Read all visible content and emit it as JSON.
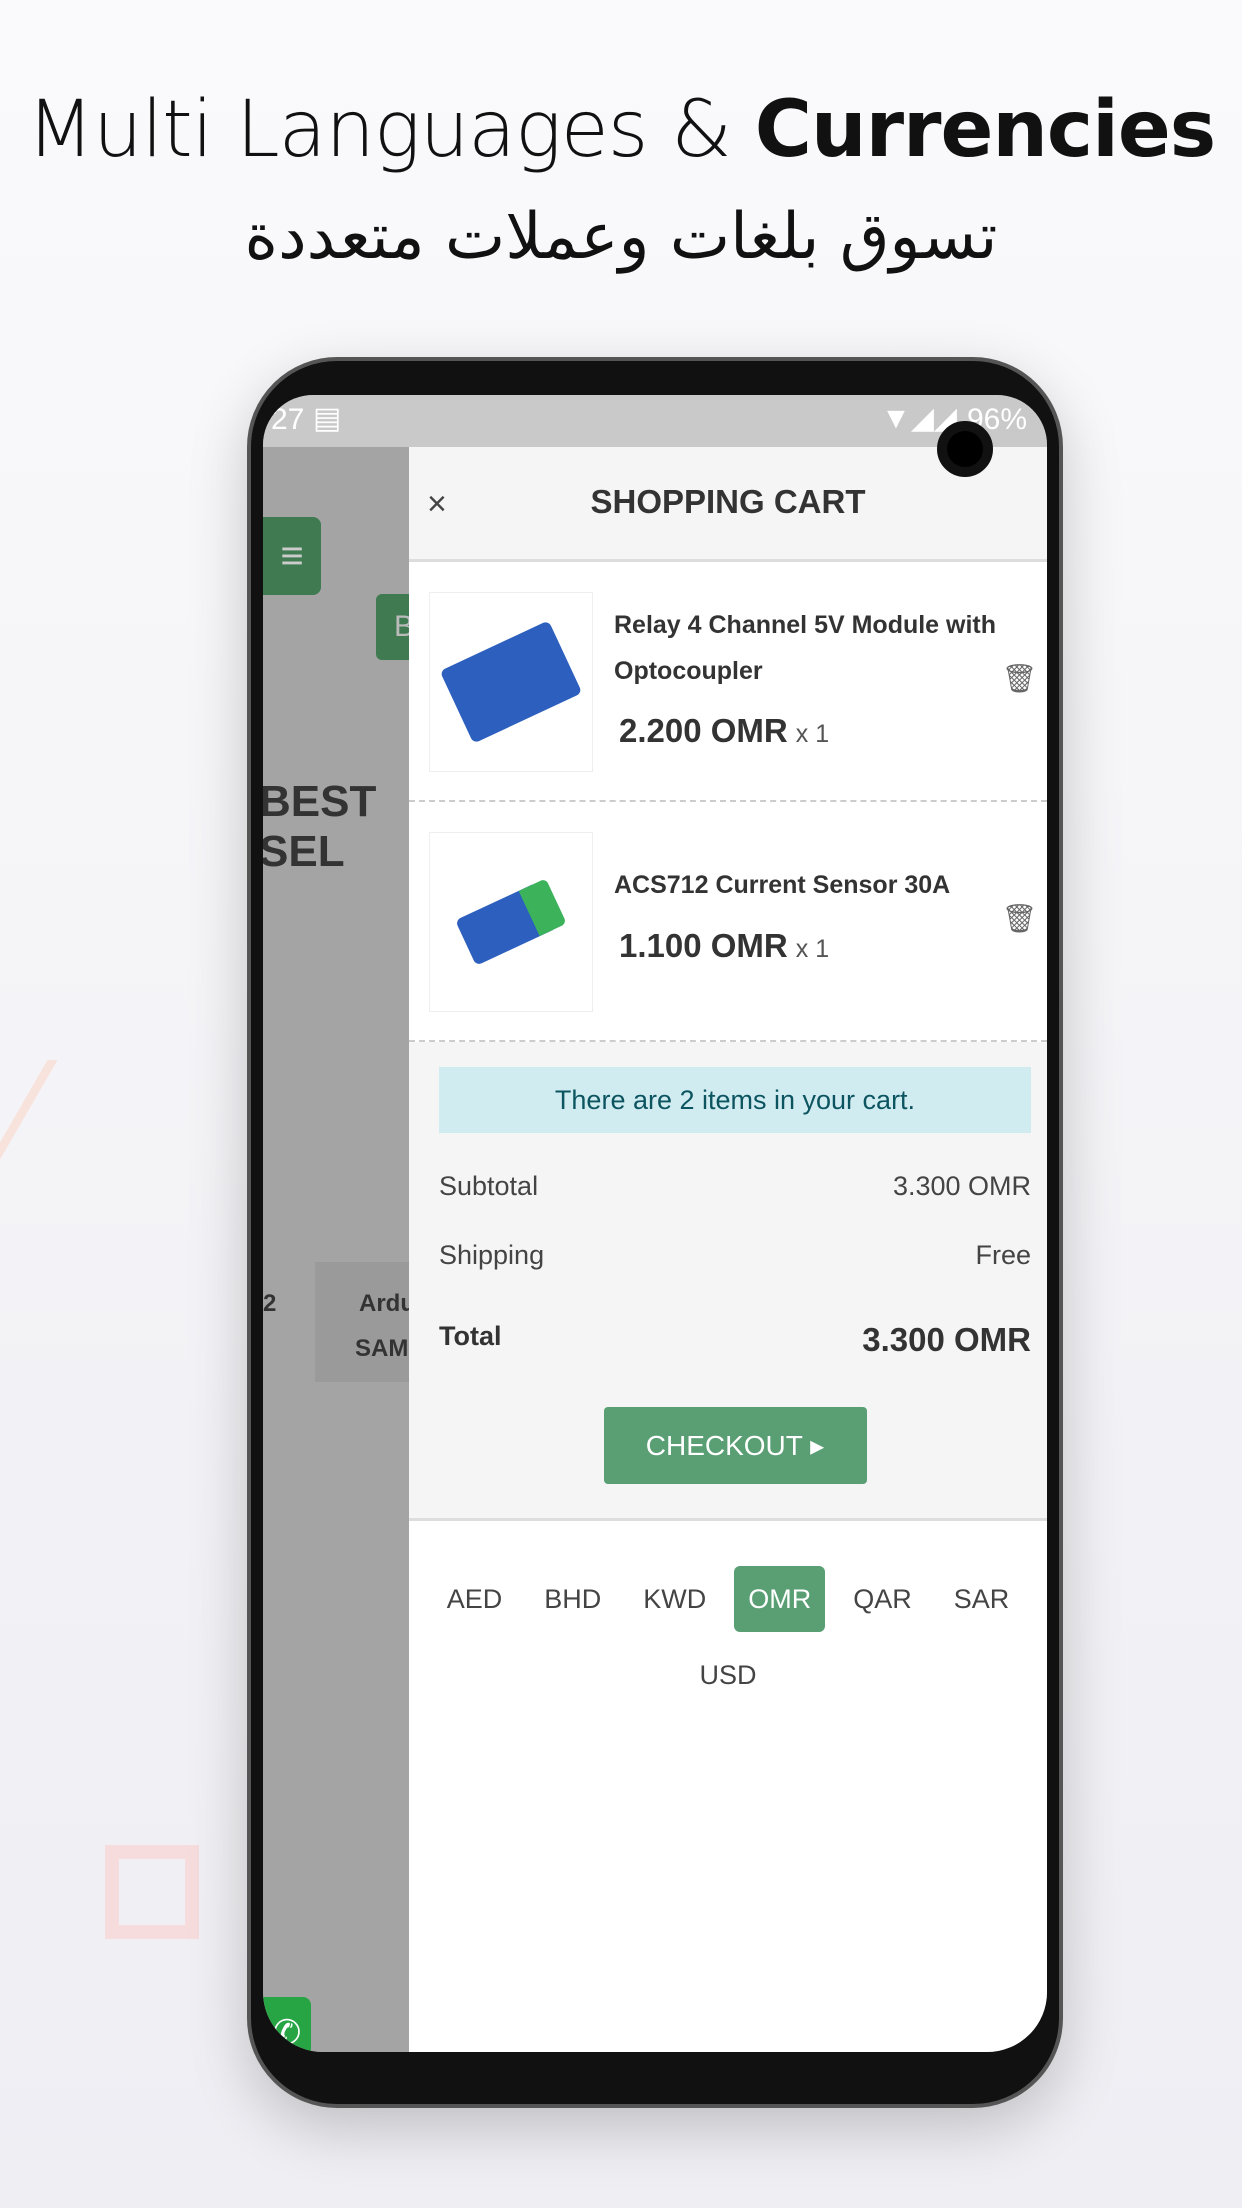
{
  "headline": {
    "text": "Multi Languages & ",
    "bold": "Currencies",
    "arabic": "تسوق بلغات وعملات متعددة"
  },
  "status": {
    "time": "27",
    "battery": "96%"
  },
  "background": {
    "section_title": "BEST SEL",
    "button_partial": "B",
    "product_partial_1": "Ardu",
    "product_partial_2": "SAM",
    "index_partial": "2"
  },
  "cart": {
    "title": "SHOPPING CART",
    "close": "×",
    "items": [
      {
        "name": "Relay 4 Channel 5V Module with Optocoupler",
        "price": "2.200 OMR",
        "qty": "x 1"
      },
      {
        "name": "ACS712 Current Sensor 30A",
        "price": "1.100 OMR",
        "qty": "x 1"
      }
    ],
    "alert": "There are 2 items in your cart.",
    "subtotal_label": "Subtotal",
    "subtotal": "3.300 OMR",
    "shipping_label": "Shipping",
    "shipping": "Free",
    "total_label": "Total",
    "total": "3.300 OMR",
    "checkout": "CHECKOUT ▸",
    "currencies": [
      "AED",
      "BHD",
      "KWD",
      "OMR",
      "QAR",
      "SAR",
      "USD"
    ],
    "selected_currency": "OMR"
  },
  "colors": {
    "accent": "#5a9f74",
    "alert_bg": "#d1ecf1"
  }
}
